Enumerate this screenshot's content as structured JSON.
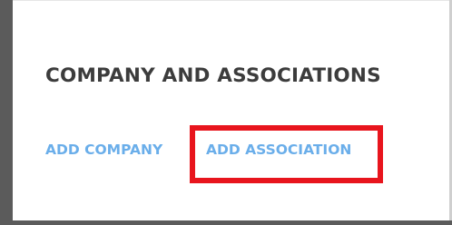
{
  "section": {
    "title": "COMPANY AND ASSOCIATIONS"
  },
  "actions": {
    "add_company_label": "ADD COMPANY",
    "add_association_label": "ADD ASSOCIATION"
  },
  "colors": {
    "link": "#6aaeea",
    "title": "#3c3c3c",
    "highlight": "#e8151d"
  }
}
